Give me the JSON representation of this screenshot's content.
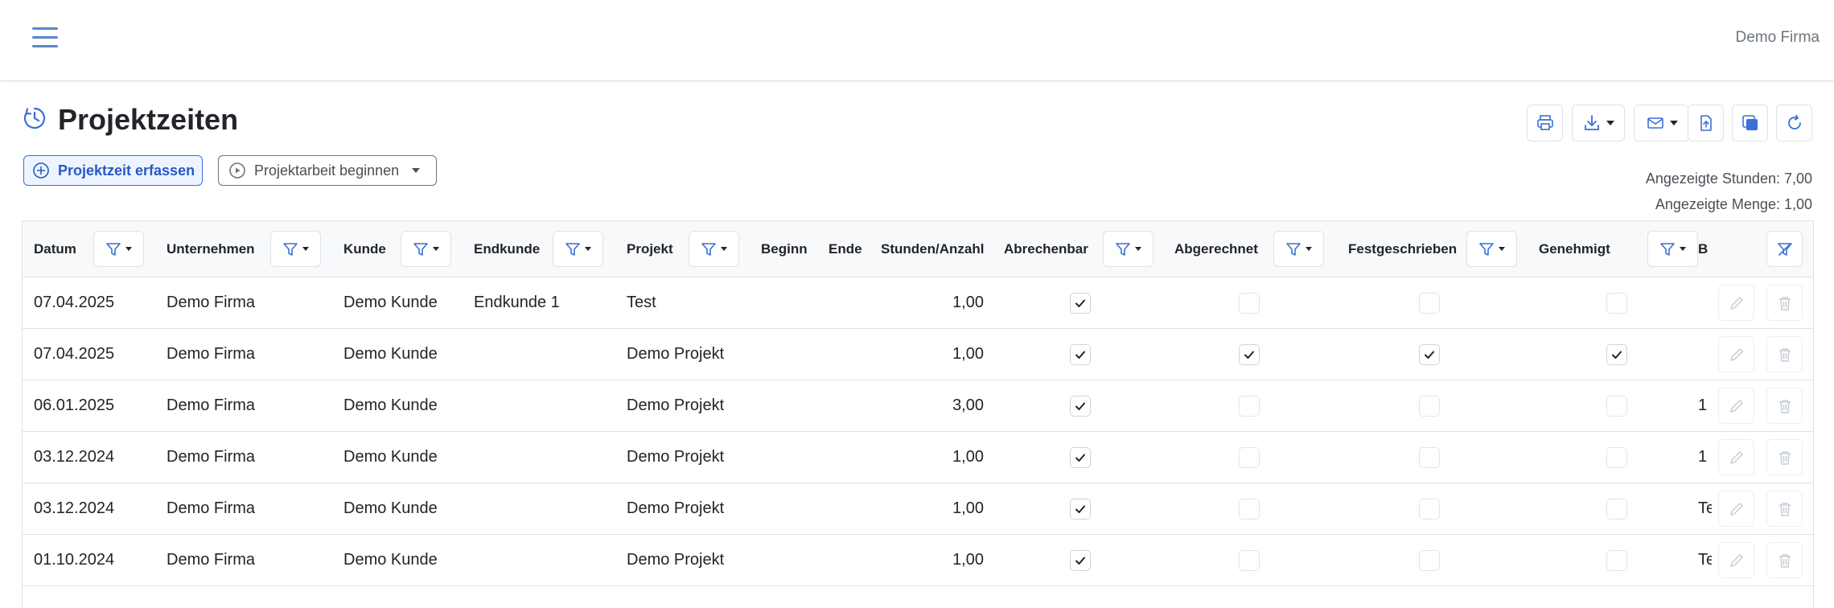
{
  "header": {
    "company": "Demo Firma"
  },
  "page": {
    "title": "Projektzeiten"
  },
  "actions": {
    "add_label": "Projektzeit erfassen",
    "start_label": "Projektarbeit beginnen"
  },
  "summary": {
    "hours": "Angezeigte Stunden: 7,00",
    "quantity": "Angezeigte Menge: 1,00"
  },
  "colors": {
    "accent": "#2759c4",
    "border": "#dee2e6"
  },
  "table": {
    "columns": [
      "Datum",
      "Unternehmen",
      "Kunde",
      "Endkunde",
      "Projekt",
      "Beginn",
      "Ende",
      "Stunden/Anzahl",
      "Abrechenbar",
      "Abgerechnet",
      "Festgeschrieben",
      "Genehmigt",
      "B"
    ],
    "rows": [
      {
        "datum": "07.04.2025",
        "unternehmen": "Demo Firma",
        "kunde": "Demo Kunde",
        "endkunde": "Endkunde 1",
        "projekt": "Test",
        "stunden": "1,00",
        "abrechenbar": true,
        "abgerechnet": false,
        "festgeschrieben": false,
        "genehmigt": false,
        "b": ""
      },
      {
        "datum": "07.04.2025",
        "unternehmen": "Demo Firma",
        "kunde": "Demo Kunde",
        "endkunde": "",
        "projekt": "Demo Projekt",
        "stunden": "1,00",
        "abrechenbar": true,
        "abgerechnet": true,
        "festgeschrieben": true,
        "genehmigt": true,
        "b": ""
      },
      {
        "datum": "06.01.2025",
        "unternehmen": "Demo Firma",
        "kunde": "Demo Kunde",
        "endkunde": "",
        "projekt": "Demo Projekt",
        "stunden": "3,00",
        "abrechenbar": true,
        "abgerechnet": false,
        "festgeschrieben": false,
        "genehmigt": false,
        "b": "1"
      },
      {
        "datum": "03.12.2024",
        "unternehmen": "Demo Firma",
        "kunde": "Demo Kunde",
        "endkunde": "",
        "projekt": "Demo Projekt",
        "stunden": "1,00",
        "abrechenbar": true,
        "abgerechnet": false,
        "festgeschrieben": false,
        "genehmigt": false,
        "b": "1"
      },
      {
        "datum": "03.12.2024",
        "unternehmen": "Demo Firma",
        "kunde": "Demo Kunde",
        "endkunde": "",
        "projekt": "Demo Projekt",
        "stunden": "1,00",
        "abrechenbar": true,
        "abgerechnet": false,
        "festgeschrieben": false,
        "genehmigt": false,
        "b": "Te"
      },
      {
        "datum": "01.10.2024",
        "unternehmen": "Demo Firma",
        "kunde": "Demo Kunde",
        "endkunde": "",
        "projekt": "Demo Projekt",
        "stunden": "1,00",
        "abrechenbar": true,
        "abgerechnet": false,
        "festgeschrieben": false,
        "genehmigt": false,
        "b": "Te"
      }
    ]
  }
}
